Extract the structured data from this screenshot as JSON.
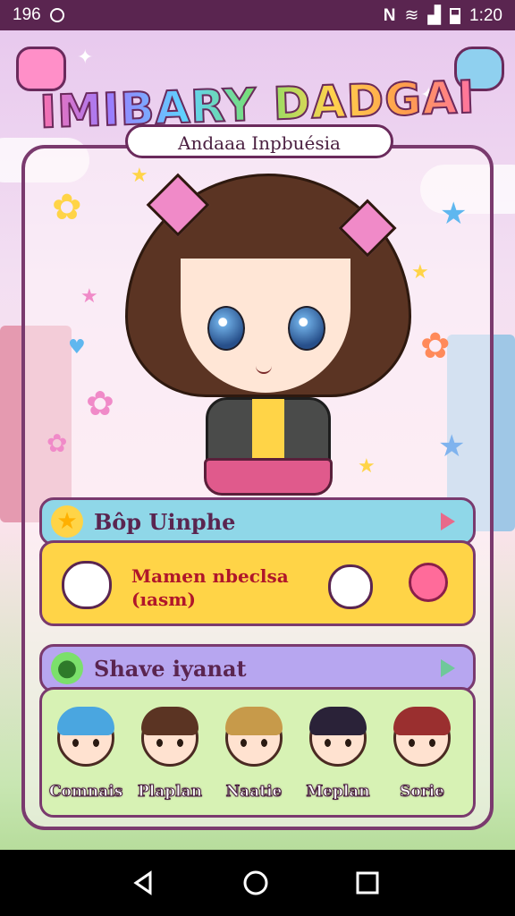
{
  "status": {
    "left_text": "196",
    "right_text": "1:20"
  },
  "header": {
    "title": "IMIBARY DADGAI",
    "subtitle": "Andaaa Inpbuésia"
  },
  "section1": {
    "label": "Bôp Uinphe"
  },
  "mood": {
    "line1": "Mamen nbeclsa",
    "line2": "(ıasm)"
  },
  "section2": {
    "label": "Shave iyanat"
  },
  "characters": [
    {
      "name": "Comnais",
      "hair": "#4aa6e0"
    },
    {
      "name": "Plaplan",
      "hair": "#5b3423"
    },
    {
      "name": "Naatie",
      "hair": "#c79a4a"
    },
    {
      "name": "Meplan",
      "hair": "#2a2238"
    },
    {
      "name": "Sorie",
      "hair": "#9a2f2f"
    }
  ],
  "colors": {
    "accent": "#7a3a6e",
    "bar1": "#8fd7e8",
    "panel1": "#ffd447",
    "bar2": "#b7a6f0",
    "panel2": "#d7f2b4"
  },
  "icons": {
    "section1": "star-icon",
    "section2": "slime-icon",
    "nav": [
      "back-icon",
      "home-icon",
      "recents-icon"
    ]
  }
}
